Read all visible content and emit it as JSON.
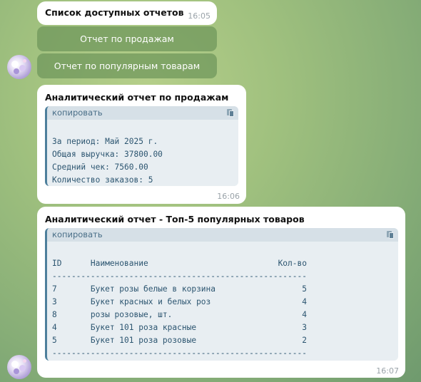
{
  "messages": [
    {
      "title": "Список доступных отчетов",
      "time": "16:05",
      "buttons": [
        "Отчет по продажам",
        "Отчет по популярным товарам"
      ]
    },
    {
      "title": "Аналитический отчет по продажам",
      "copy_label": "копировать",
      "lines": [
        "За период: Май 2025 г.",
        "Общая выручка: 37800.00",
        "Средний чек: 7560.00",
        "Количество заказов: 5"
      ],
      "time": "16:06"
    },
    {
      "title": "Аналитический отчет - Топ-5 популярных товаров",
      "copy_label": "копировать",
      "lines": [
        "ID      Наименование                           Кол-во",
        "-----------------------------------------------------",
        "7       Букет розы белые в корзина                  5",
        "3       Букет красных и белых роз                   4",
        "8       розы розовые, шт.                           4",
        "4       Букет 101 роза красные                      3",
        "5       Букет 101 роза розовые                      2",
        "-----------------------------------------------------"
      ],
      "time": "16:07"
    }
  ]
}
